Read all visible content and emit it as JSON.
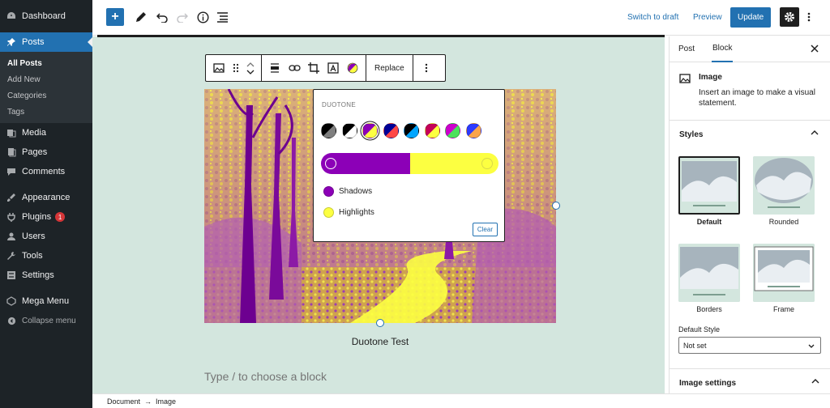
{
  "admin_menu": {
    "items": [
      {
        "label": "Dashboard",
        "icon": "dashboard-icon"
      },
      {
        "label": "Posts",
        "icon": "pin-icon",
        "active": true
      },
      {
        "label": "Media",
        "icon": "media-icon"
      },
      {
        "label": "Pages",
        "icon": "pages-icon"
      },
      {
        "label": "Comments",
        "icon": "comments-icon"
      },
      {
        "label": "Appearance",
        "icon": "appearance-icon"
      },
      {
        "label": "Plugins",
        "icon": "plugins-icon",
        "badge": "1"
      },
      {
        "label": "Users",
        "icon": "users-icon"
      },
      {
        "label": "Tools",
        "icon": "tools-icon"
      },
      {
        "label": "Settings",
        "icon": "settings-icon"
      },
      {
        "label": "Mega Menu",
        "icon": "mega-menu-icon"
      }
    ],
    "submenu": [
      "All Posts",
      "Add New",
      "Categories",
      "Tags"
    ],
    "collapse_label": "Collapse menu"
  },
  "header": {
    "switch_to_draft": "Switch to draft",
    "preview": "Preview",
    "update": "Update"
  },
  "block_toolbar": {
    "replace": "Replace"
  },
  "duotone": {
    "title": "DUOTONE",
    "swatches": [
      [
        "#000000",
        "#7f7f7f"
      ],
      [
        "#000000",
        "#ffffff"
      ],
      [
        "#8c00b7",
        "#fcff41"
      ],
      [
        "#000097",
        "#ff4747"
      ],
      [
        "#000000",
        "#00a5ff"
      ],
      [
        "#c60059",
        "#fcff41"
      ],
      [
        "#cc00cc",
        "#4be25b"
      ],
      [
        "#2d3aff",
        "#f9a44b"
      ]
    ],
    "shadow_color": "#8c00b7",
    "highlight_color": "#fcff41",
    "shadows_label": "Shadows",
    "highlights_label": "Highlights",
    "clear_label": "Clear"
  },
  "image": {
    "caption": "Duotone Test"
  },
  "appender": {
    "placeholder": "Type / to choose a block"
  },
  "breadcrumb": {
    "items": [
      "Document",
      "Image"
    ],
    "separator": "→"
  },
  "panel": {
    "tabs": [
      "Post",
      "Block"
    ],
    "active_tab": "Block",
    "block_name": "Image",
    "block_description": "Insert an image to make a visual statement.",
    "styles_title": "Styles",
    "styles": [
      "Default",
      "Rounded",
      "Borders",
      "Frame"
    ],
    "default_style_label": "Default Style",
    "default_style_value": "Not set",
    "image_settings_title": "Image settings"
  },
  "colors": {
    "accent": "#2271b1",
    "canvas_bg": "#d3e6de",
    "admin_bg": "#1d2327"
  }
}
